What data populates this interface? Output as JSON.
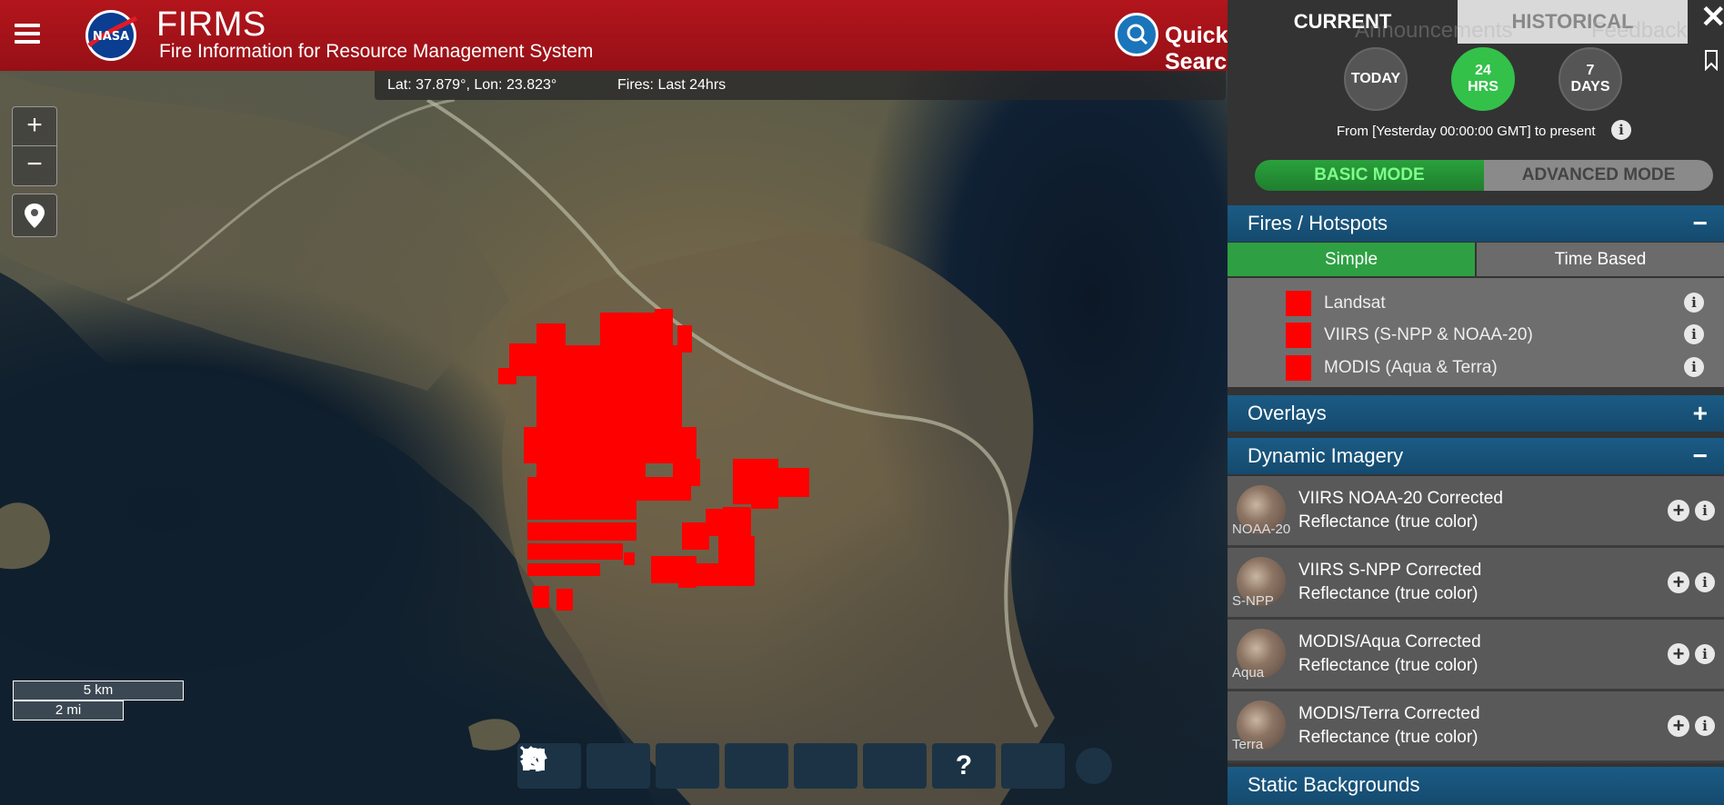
{
  "header": {
    "title": "FIRMS",
    "subtitle": "Fire Information for Resource Management System",
    "quick_search": "Quick Search",
    "ghost_links": [
      "Announcements",
      "Feedback"
    ]
  },
  "map": {
    "coords": "Lat: 37.879°, Lon: 23.823°",
    "fires_period": "Fires: Last 24hrs",
    "zoom_in": "+",
    "zoom_out": "−",
    "scale_km": "5 km",
    "scale_mi": "2 mi",
    "fire_color": "#ff0000"
  },
  "toolbar": {
    "items": [
      "ruler-icon",
      "pin-icon",
      "layers-icon",
      "sliders-icon",
      "camera-icon",
      "share-icon",
      "help-icon",
      "fullscreen-icon"
    ],
    "help": "?"
  },
  "panel": {
    "tabs": {
      "current": "CURRENT",
      "historical": "HISTORICAL"
    },
    "close": "✕",
    "periods": [
      {
        "label": "TODAY",
        "active": false
      },
      {
        "label": "24 HRS",
        "active": true
      },
      {
        "label": "7 DAYS",
        "active": false
      }
    ],
    "from_text": "From [Yesterday 00:00:00 GMT] to present",
    "modes": {
      "basic": "BASIC MODE",
      "advanced": "ADVANCED MODE"
    },
    "sections": {
      "fires": {
        "title": "Fires / Hotspots",
        "control": "−"
      },
      "overlays": {
        "title": "Overlays",
        "control": "+"
      },
      "dynamic": {
        "title": "Dynamic Imagery",
        "control": "−"
      },
      "static": {
        "title": "Static Backgrounds"
      }
    },
    "fire_subtabs": {
      "simple": "Simple",
      "time_based": "Time Based"
    },
    "fire_layers": [
      "Landsat",
      "VIIRS (S-NPP & NOAA-20)",
      "MODIS (Aqua & Terra)"
    ],
    "imagery": [
      {
        "thumb": "NOAA-20",
        "title": "VIIRS NOAA-20 Corrected Reflectance (true color)"
      },
      {
        "thumb": "S-NPP",
        "title": "VIIRS S-NPP Corrected Reflectance (true color)"
      },
      {
        "thumb": "Aqua",
        "title": "MODIS/Aqua Corrected Reflectance (true color)"
      },
      {
        "thumb": "Terra",
        "title": "MODIS/Terra Corrected Reflectance (true color)"
      }
    ],
    "info": "i",
    "add": "+"
  },
  "colors": {
    "header_red": "#a8121a",
    "active_green": "#33c14a",
    "section_blue": "#1b5b85"
  }
}
